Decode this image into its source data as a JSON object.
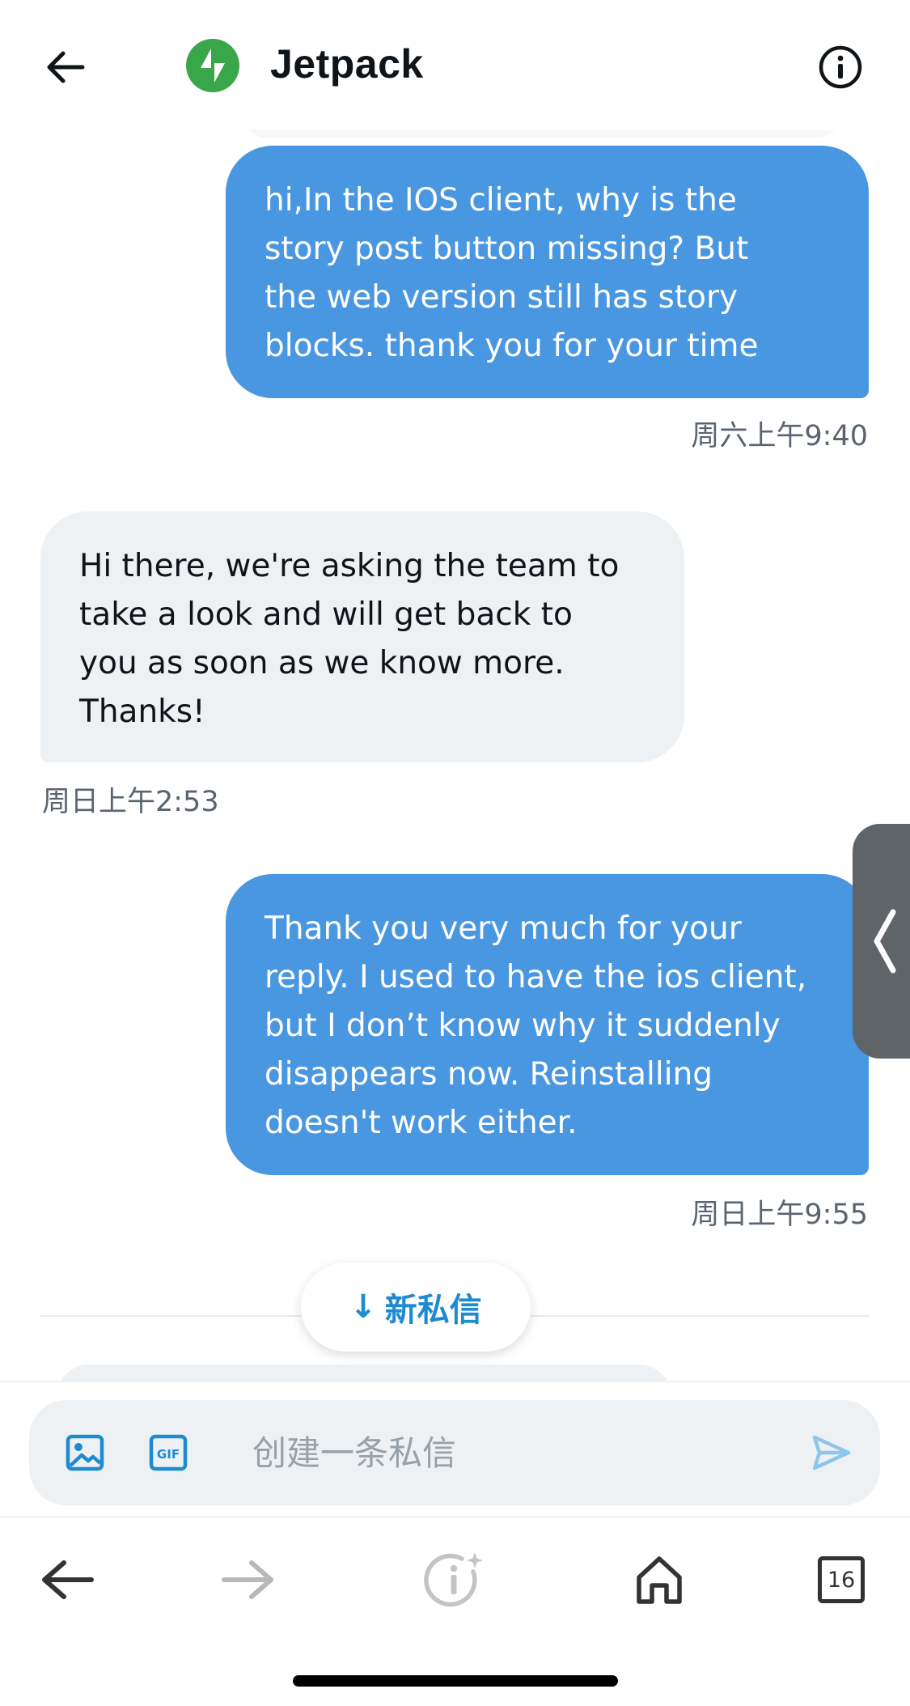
{
  "header": {
    "title": "Jetpack",
    "avatar_icon": "jetpack-bolt-icon",
    "back_icon": "arrow-left-icon",
    "info_icon": "info-circle-icon",
    "avatar_color": "#3aa64a"
  },
  "messages": [
    {
      "direction": "outgoing",
      "lines": [
        "hi,In the IOS client, why is the",
        "story post button missing? But",
        "the web version still has story",
        "blocks. thank you for your time"
      ],
      "timestamp": "周六上午9:40"
    },
    {
      "direction": "incoming",
      "lines": [
        "Hi there, we're asking the team to",
        "take a look and will get back to",
        "you as soon as we know more.",
        "Thanks!"
      ],
      "timestamp": "周日上午2:53"
    },
    {
      "direction": "outgoing",
      "lines": [
        "Thank you very much for your",
        "reply. I used to have the ios client,",
        "but I don’t know why it suddenly",
        "disappears now. Reinstalling",
        "doesn't work either."
      ],
      "timestamp": "周日上午9:55"
    }
  ],
  "new_messages_pill": {
    "arrow": "↓",
    "label": "新私信"
  },
  "composer": {
    "placeholder": "创建一条私信",
    "value": "",
    "image_icon": "image-icon",
    "gif_icon": "gif-icon",
    "gif_label": "GIF",
    "send_icon": "send-icon"
  },
  "toolbar": {
    "back_icon": "arrow-left-icon",
    "forward_icon": "arrow-right-icon",
    "info_icon": "info-sparkle-icon",
    "home_icon": "home-icon",
    "tabs_count": "16"
  },
  "colors": {
    "outgoing_bubble": "#4a97e1",
    "incoming_bubble": "#eef1f3",
    "accent": "#1d8bd1",
    "drawer_handle": "#5f6469"
  }
}
